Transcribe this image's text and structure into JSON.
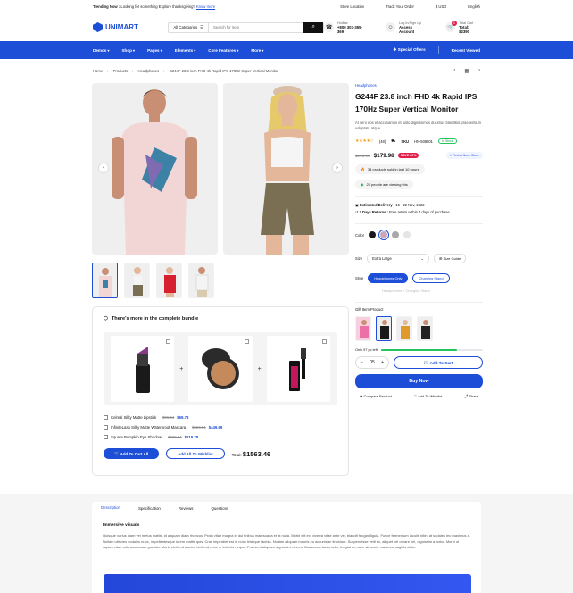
{
  "topbar": {
    "trending_label": "Trending Now :",
    "trending_text": "Looking for something Explore thanksgiving?",
    "trending_link": "Know more",
    "store_location": "Store Location",
    "track_order": "Track Your Order",
    "currency": "$ USD",
    "language": "English"
  },
  "header": {
    "logo": "UNIMART",
    "category": "All Categories",
    "search_placeholder": "Search for item",
    "hotline_label": "Hotline",
    "hotline_value": "+800 303-355-369",
    "account_label": "Log In/Sign Up",
    "account_value": "Access Account",
    "cart_label": "Total Cart",
    "cart_value": "Total: $2390",
    "cart_count": "0"
  },
  "nav": {
    "items": [
      "Demos",
      "Shop",
      "Pages",
      "Elements",
      "Core Features",
      "More"
    ],
    "special_offers": "Special Offers",
    "recent_viewed": "Recent Viewed"
  },
  "breadcrumb": [
    "Home",
    "Products",
    "Headphones",
    "G244F 23.8 inch FHD 4k Rapid IPS 170Hz Super Vertical Monitor"
  ],
  "bundle": {
    "title": "There's more in the complete bundle",
    "items": [
      {
        "name": "Celmal Silky Matte Lipstick",
        "old": "$96.54",
        "price": "$69.78"
      },
      {
        "name": "InfiniteLash Silky Matte Waterproof Mascara",
        "old": "$656.54",
        "price": "$449.69"
      },
      {
        "name": "Square Pumpkin Eye Shadow",
        "old": "$339.54",
        "price": "$219.78"
      }
    ],
    "add_all_cart": "Add To Cart All",
    "add_all_wishlist": "Add All To Wishlist",
    "total_label": "Total:",
    "total_value": "$1563.46"
  },
  "product": {
    "brand": "Headphones",
    "title": "G244F 23.8 inch FHD 4k Rapid IPS 170Hz Super Vertical Monitor",
    "description": "At vero eos et accusamus et iusto dignissimos ducimus blanditiis praesentium voluptatu atque...",
    "reviews": "(48)",
    "sku_label": "SKU",
    "sku": "HN-508801",
    "stock": "In Stock",
    "rating": 4,
    "old_price": "$295.00",
    "price": "$179.98",
    "save": "SAVE 20%",
    "find_store": "Find A Near Store",
    "sold_text": "34 products sold in last 10 hours",
    "viewing_text": "20 people are viewing this",
    "delivery_label": "Estimated Delivery :",
    "delivery_value": "15 - 22 Nov, 2022",
    "returns_label": "7 Days Returns :",
    "returns_value": "Free return within 7 days of purchase",
    "color_label": "Color",
    "colors": [
      "#1a1a1a",
      "#c9a9b8",
      "#a8a8a8",
      "#e5e5e5"
    ],
    "size_label": "Size",
    "size_value": "Extra Large",
    "size_guide": "Size Guide",
    "style_label": "Style",
    "styles": [
      "Headphones Only",
      "Charging Stand",
      "Headphones + Charging Stand"
    ],
    "gift_label": "Gift Item/Product",
    "stock_left": "Only 97 pc left",
    "stock_level": 0.75,
    "qty": "05",
    "add_to_cart": "Add To Cart",
    "buy_now": "Buy Now",
    "compare": "Compare Product",
    "wishlist": "Add To Wishlist",
    "share": "Share"
  },
  "tabs": [
    "Description",
    "Specification",
    "Reviews",
    "Questions"
  ],
  "description": {
    "heading": "Immersive visuals",
    "text": "Quisque varius diam vel metus mattis, id aliquam diam rhoncus. Proin vitae magna in dui finibus malesuada et at nulla. Morbi elit ex, viverra vitae ante vel, blandit feugiat ligula. Fusce fermentum iaculis nibh, at sodales leo maximus a. Nullam ultricies sodales nunc, in pellentesque lorem mattis quis. Cras imperdiet est in nunc tristique lacinia. Nullam aliquam mauris eu accumsan tincidunt. Suspendisse velit ex, aliquet vel ornare vel, dignissim a tortor. Morbi ut sapien vitae odio accumsan gravida. Morbi eleifend auctor, eleifend nunc a, lobortis neque. Praesent aliquam dignissim viverra. Maecenas lacus odio, feugiat eu nunc sit amet, maximus sagittis dolor."
  }
}
